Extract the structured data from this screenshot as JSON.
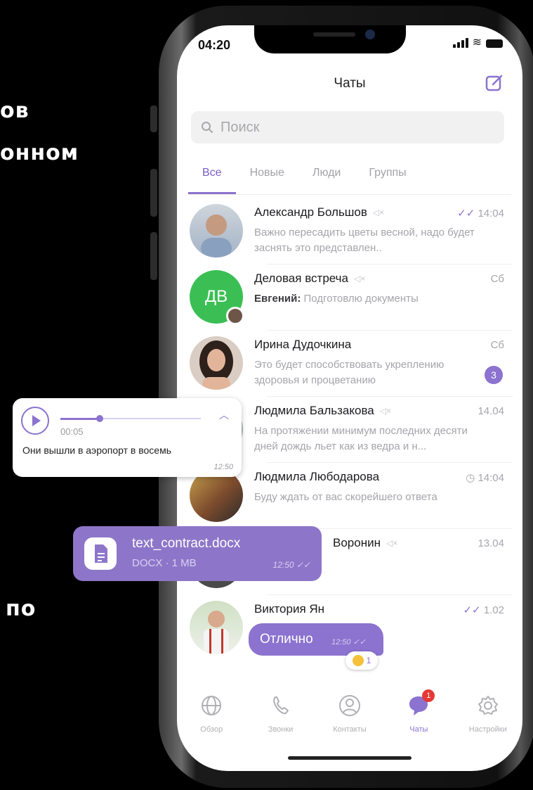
{
  "background": {
    "line1": "ов",
    "line2": "онном",
    "line3": "по"
  },
  "status": {
    "time": "04:20"
  },
  "header": {
    "title": "Чаты"
  },
  "search": {
    "placeholder": "Поиск"
  },
  "tabs": [
    {
      "label": "Все",
      "active": true
    },
    {
      "label": "Новые"
    },
    {
      "label": "Люди"
    },
    {
      "label": "Группы"
    }
  ],
  "chats": [
    {
      "name": "Александр Большов",
      "time": "14:04",
      "message": "Важно пересадить цветы весной, надо будет заснять это представлен..",
      "muted": true,
      "read": true
    },
    {
      "name": "Деловая встреча",
      "time": "Сб",
      "sender": "Евгений:",
      "message": "Подготовлю документы",
      "muted": true,
      "initials": "ДВ"
    },
    {
      "name": "Ирина Дудочкина",
      "time": "Сб",
      "message": "Это будет способствовать укреплению здоровья и процветанию",
      "unread": "3"
    },
    {
      "name": "Людмила Бальзакова",
      "time": "14.04",
      "message": "На протяжении минимум последних десяти дней дождь льет как из ведра и н...",
      "muted": true
    },
    {
      "name": "Людмила Любодарова",
      "time": "14:04",
      "message": "Буду ждать от вас скорейшего ответа"
    },
    {
      "name": "Воронин",
      "time": "13.04",
      "message": "",
      "muted": true
    },
    {
      "name": "Виктория Ян",
      "time": "1.02",
      "message": "",
      "read": true
    }
  ],
  "voice_message": {
    "duration": "00:05",
    "text": "Они вышли в аэропорт в восемь",
    "time": "12:50",
    "progress": 0.28
  },
  "document": {
    "name": "text_contract.docx",
    "size": "DOCX · 1 MB",
    "time": "12:50"
  },
  "reply": {
    "text": "Отлично",
    "time": "12:50",
    "reaction_count": "1"
  },
  "tabbar": [
    {
      "label": "Обзор",
      "icon": "globe-icon"
    },
    {
      "label": "Звонки",
      "icon": "phone-icon"
    },
    {
      "label": "Контакты",
      "icon": "contact-icon"
    },
    {
      "label": "Чаты",
      "icon": "chat-icon",
      "active": true,
      "badge": "1"
    },
    {
      "label": "Настройки",
      "icon": "gear-icon"
    }
  ],
  "colors": {
    "accent": "#8b73cf",
    "muted_text": "#a5a5ab",
    "green": "#3bbf54"
  }
}
